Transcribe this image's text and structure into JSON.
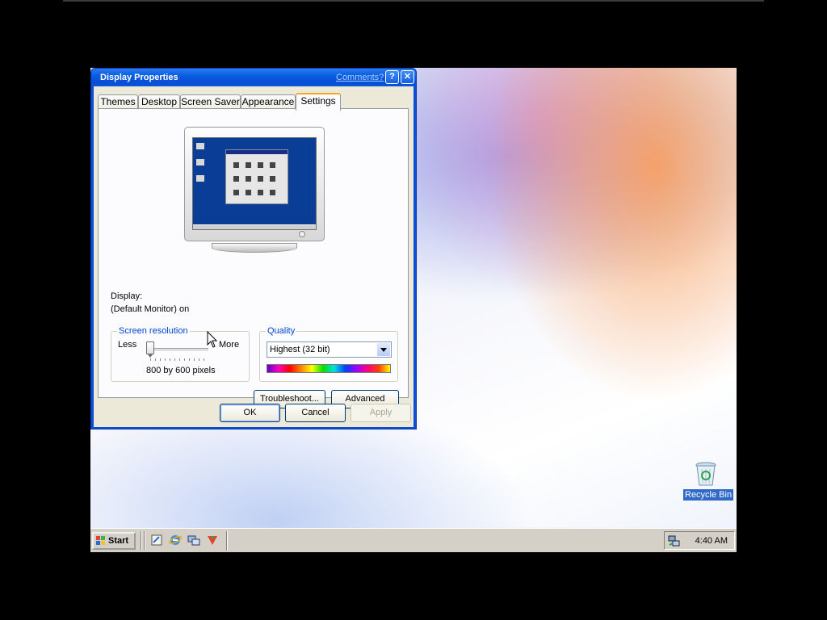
{
  "dialog": {
    "title": "Display Properties",
    "comments_link": "Comments?",
    "help_button": "?",
    "close_button": "✕",
    "tabs": [
      {
        "label": "Themes",
        "active": false
      },
      {
        "label": "Desktop",
        "active": false
      },
      {
        "label": "Screen Saver",
        "active": false
      },
      {
        "label": "Appearance",
        "active": false
      },
      {
        "label": "Settings",
        "active": true
      }
    ],
    "display_label": "Display:",
    "display_value": "(Default Monitor) on",
    "resolution": {
      "legend": "Screen resolution",
      "less": "Less",
      "more": "More",
      "value_text": "800 by 600 pixels",
      "slider_level": 0
    },
    "quality": {
      "legend": "Quality",
      "selected": "Highest (32 bit)"
    },
    "buttons": {
      "troubleshoot": "Troubleshoot...",
      "advanced": "Advanced",
      "ok": "OK",
      "cancel": "Cancel",
      "apply": "Apply"
    }
  },
  "desktop": {
    "recycle_bin_label": "Recycle Bin"
  },
  "taskbar": {
    "start_label": "Start",
    "quick_launch": [
      "show-desktop-icon",
      "internet-explorer-icon",
      "network-icon",
      "media-icon"
    ],
    "clock": "4:40 AM"
  },
  "colors": {
    "title_blue": "#0a5de0",
    "dialog_bg": "#ece9d8",
    "taskbar": "#d4d0c8",
    "selection": "#3169c6"
  }
}
